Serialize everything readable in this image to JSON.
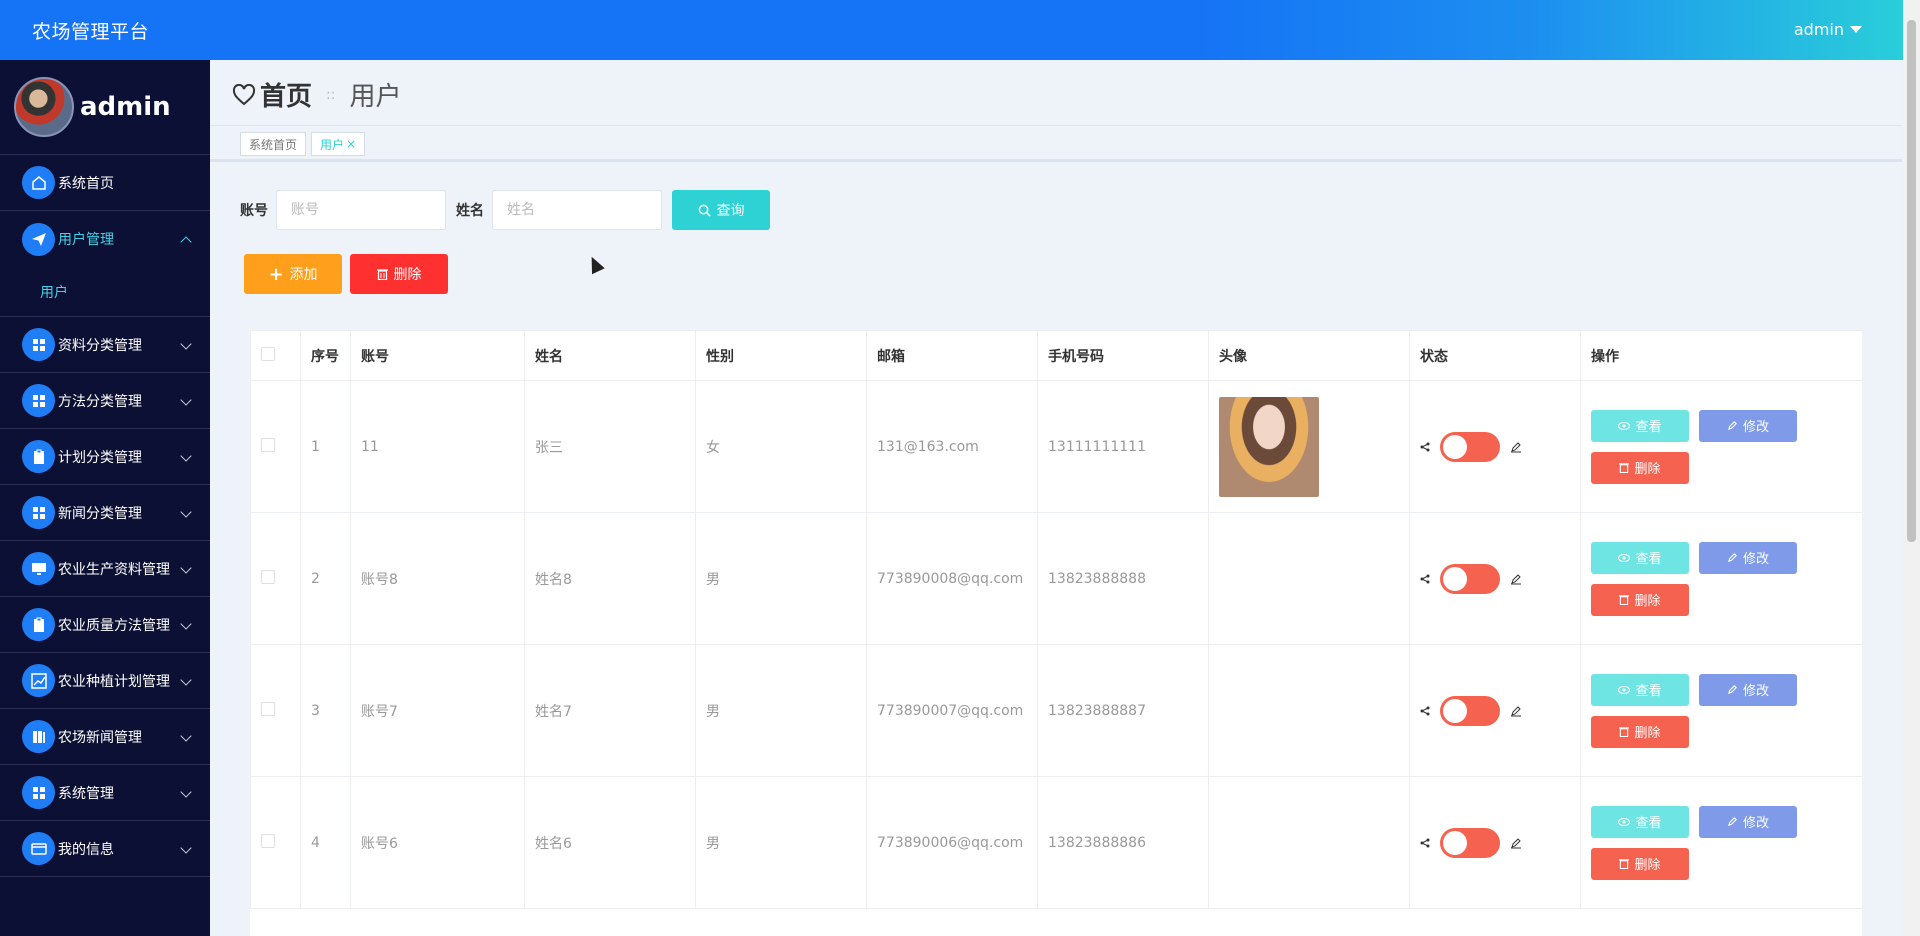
{
  "header": {
    "brand": "农场管理平台",
    "user": "admin"
  },
  "sidebar": {
    "profile_name": "admin",
    "items": [
      {
        "label": "系统首页",
        "icon": "home-icon",
        "open": false,
        "chevron": false
      },
      {
        "label": "用户管理",
        "icon": "send-icon",
        "open": true,
        "chevron": true,
        "children": [
          {
            "label": "用户"
          }
        ]
      },
      {
        "label": "资料分类管理",
        "icon": "grid-icon",
        "open": false,
        "chevron": true
      },
      {
        "label": "方法分类管理",
        "icon": "grid-icon",
        "open": false,
        "chevron": true
      },
      {
        "label": "计划分类管理",
        "icon": "clipboard-icon",
        "open": false,
        "chevron": true
      },
      {
        "label": "新闻分类管理",
        "icon": "grid-icon",
        "open": false,
        "chevron": true
      },
      {
        "label": "农业生产资料管理",
        "icon": "monitor-icon",
        "open": false,
        "chevron": true
      },
      {
        "label": "农业质量方法管理",
        "icon": "clipboard-icon",
        "open": false,
        "chevron": true
      },
      {
        "label": "农业种植计划管理",
        "icon": "chart-icon",
        "open": false,
        "chevron": true
      },
      {
        "label": "农场新闻管理",
        "icon": "book-icon",
        "open": false,
        "chevron": true
      },
      {
        "label": "系统管理",
        "icon": "grid-icon",
        "open": false,
        "chevron": true
      },
      {
        "label": "我的信息",
        "icon": "card-icon",
        "open": false,
        "chevron": true
      }
    ]
  },
  "breadcrumb": {
    "home": "首页",
    "separator": "::",
    "current": "用户"
  },
  "tabs": [
    {
      "label": "系统首页",
      "active": false
    },
    {
      "label": "用户",
      "active": true,
      "close": "×"
    }
  ],
  "search": {
    "account_label": "账号",
    "account_placeholder": "账号",
    "name_label": "姓名",
    "name_placeholder": "姓名",
    "query_button": "查询"
  },
  "actions": {
    "add_button": "添加",
    "delete_button": "删除"
  },
  "table": {
    "columns": [
      "",
      "序号",
      "账号",
      "姓名",
      "性别",
      "邮箱",
      "手机号码",
      "头像",
      "状态",
      "操作"
    ],
    "rows": [
      {
        "index": "1",
        "account": "11",
        "name": "张三",
        "gender": "女",
        "email": "131@163.com",
        "phone": "13111111111",
        "has_photo": true
      },
      {
        "index": "2",
        "account": "账号8",
        "name": "姓名8",
        "gender": "男",
        "email": "773890008@qq.com",
        "phone": "13823888888",
        "has_photo": false
      },
      {
        "index": "3",
        "account": "账号7",
        "name": "姓名7",
        "gender": "男",
        "email": "773890007@qq.com",
        "phone": "13823888887",
        "has_photo": false
      },
      {
        "index": "4",
        "account": "账号6",
        "name": "姓名6",
        "gender": "男",
        "email": "773890006@qq.com",
        "phone": "13823888886",
        "has_photo": false
      }
    ],
    "op_labels": {
      "view": "查看",
      "edit": "修改",
      "delete": "删除"
    }
  },
  "colors": {
    "primary": "#1573f5",
    "sidebar": "#0c1034",
    "accent": "#2ed1d4",
    "warn": "#ff9f1c",
    "danger": "#ff3030",
    "toggle": "#f5624f"
  }
}
